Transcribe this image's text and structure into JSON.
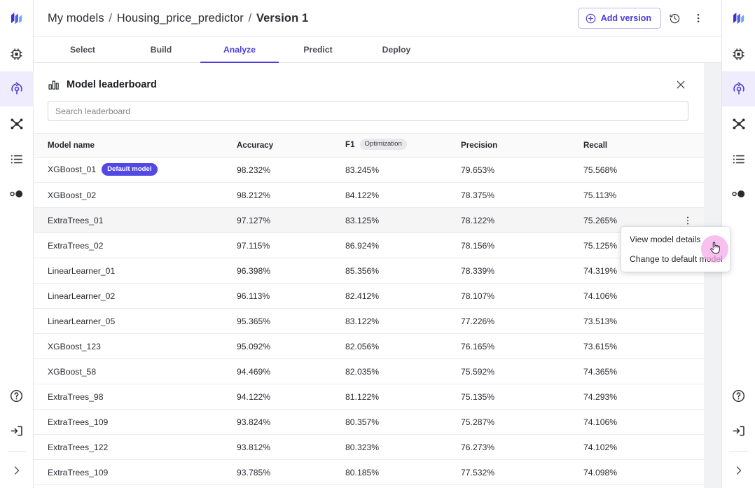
{
  "colors": {
    "accent": "#4c3fd8",
    "badge_default": "#5248e4",
    "rail_active_bg": "#eeecfd",
    "chip_bg": "#e9e9ec",
    "row_hover": "#f5f5f6",
    "cursor_blob": "#f5a8e8",
    "panel_bg": "#ffffff",
    "page_bg": "#f1f2f4"
  },
  "left_rail": {
    "items": [
      {
        "name": "app-logo",
        "icon": "logo-icon",
        "active": false
      },
      {
        "name": "sidebar-item-compute",
        "icon": "chip-icon",
        "active": false
      },
      {
        "name": "sidebar-item-models",
        "icon": "model-deploy-icon",
        "active": true
      },
      {
        "name": "sidebar-item-pipelines",
        "icon": "network-nodes-icon",
        "active": false
      },
      {
        "name": "sidebar-item-datasets",
        "icon": "list-icon",
        "active": false
      },
      {
        "name": "sidebar-item-experiments",
        "icon": "circles-icon",
        "active": false
      }
    ],
    "bottom_items": [
      {
        "name": "sidebar-item-help",
        "icon": "question-circle-icon"
      },
      {
        "name": "sidebar-item-signout",
        "icon": "sign-in-icon"
      },
      {
        "name": "sidebar-item-expand",
        "icon": "chevron-right-icon"
      }
    ]
  },
  "right_rail": {
    "items": [
      {
        "name": "app-logo",
        "icon": "logo-icon",
        "active": false
      },
      {
        "name": "sidebar-item-compute",
        "icon": "chip-icon",
        "active": false
      },
      {
        "name": "sidebar-item-models",
        "icon": "model-deploy-icon",
        "active": true
      },
      {
        "name": "sidebar-item-pipelines",
        "icon": "network-nodes-icon",
        "active": false
      },
      {
        "name": "sidebar-item-datasets",
        "icon": "list-icon",
        "active": false
      },
      {
        "name": "sidebar-item-experiments",
        "icon": "circles-icon",
        "active": false
      }
    ],
    "bottom_items": [
      {
        "name": "sidebar-item-help",
        "icon": "question-circle-icon"
      },
      {
        "name": "sidebar-item-signout",
        "icon": "sign-in-icon"
      },
      {
        "name": "sidebar-item-expand",
        "icon": "chevron-right-icon"
      }
    ]
  },
  "header": {
    "breadcrumb": {
      "root": "My models",
      "model": "Housing_price_predictor",
      "version": "Version 1",
      "separator": "/"
    },
    "add_version_label": "Add version",
    "add_version_icon": "plus-circle-icon",
    "history_icon": "history-clock-icon",
    "more_icon": "kebab-menu-icon"
  },
  "tabs": [
    {
      "label": "Select",
      "active": false
    },
    {
      "label": "Build",
      "active": false
    },
    {
      "label": "Analyze",
      "active": true
    },
    {
      "label": "Predict",
      "active": false
    },
    {
      "label": "Deploy",
      "active": false
    }
  ],
  "panel": {
    "title": "Model leaderboard",
    "title_icon": "bar-chart-icon",
    "close_icon": "close-icon",
    "search": {
      "placeholder": "Search leaderboard",
      "value": ""
    }
  },
  "table": {
    "columns": [
      {
        "label": "Model name",
        "chip": null
      },
      {
        "label": "Accuracy",
        "chip": null
      },
      {
        "label": "F1",
        "chip": "Optimization"
      },
      {
        "label": "Precision",
        "chip": null
      },
      {
        "label": "Recall",
        "chip": null
      }
    ],
    "rows": [
      {
        "name": "XGBoost_01",
        "badge": "Default model",
        "accuracy": "98.232%",
        "f1": "83.245%",
        "precision": "79.653%",
        "recall": "75.568%",
        "hovered": false,
        "kebab": false
      },
      {
        "name": "XGBoost_02",
        "badge": null,
        "accuracy": "98.212%",
        "f1": "84.122%",
        "precision": "78.375%",
        "recall": "75.113%",
        "hovered": false,
        "kebab": false
      },
      {
        "name": "ExtraTrees_01",
        "badge": null,
        "accuracy": "97.127%",
        "f1": "83.125%",
        "precision": "78.122%",
        "recall": "75.265%",
        "hovered": true,
        "kebab": true
      },
      {
        "name": "ExtraTrees_02",
        "badge": null,
        "accuracy": "97.115%",
        "f1": "86.924%",
        "precision": "78.156%",
        "recall": "75.125%",
        "hovered": false,
        "kebab": false
      },
      {
        "name": "LinearLearner_01",
        "badge": null,
        "accuracy": "96.398%",
        "f1": "85.356%",
        "precision": "78.339%",
        "recall": "74.319%",
        "hovered": false,
        "kebab": false
      },
      {
        "name": "LinearLearner_02",
        "badge": null,
        "accuracy": "96.113%",
        "f1": "82.412%",
        "precision": "78.107%",
        "recall": "74.106%",
        "hovered": false,
        "kebab": false
      },
      {
        "name": "LinearLearner_05",
        "badge": null,
        "accuracy": "95.365%",
        "f1": "83.122%",
        "precision": "77.226%",
        "recall": "73.513%",
        "hovered": false,
        "kebab": false
      },
      {
        "name": "XGBoost_123",
        "badge": null,
        "accuracy": "95.092%",
        "f1": "82.056%",
        "precision": "76.165%",
        "recall": "73.615%",
        "hovered": false,
        "kebab": false
      },
      {
        "name": "XGBoost_58",
        "badge": null,
        "accuracy": "94.469%",
        "f1": "82.035%",
        "precision": "75.592%",
        "recall": "74.365%",
        "hovered": false,
        "kebab": false
      },
      {
        "name": "ExtraTrees_98",
        "badge": null,
        "accuracy": "94.122%",
        "f1": "81.122%",
        "precision": "75.135%",
        "recall": "74.293%",
        "hovered": false,
        "kebab": false
      },
      {
        "name": "ExtraTrees_109",
        "badge": null,
        "accuracy": "93.824%",
        "f1": "80.357%",
        "precision": "75.287%",
        "recall": "74.106%",
        "hovered": false,
        "kebab": false
      },
      {
        "name": "ExtraTrees_122",
        "badge": null,
        "accuracy": "93.812%",
        "f1": "80.323%",
        "precision": "76.273%",
        "recall": "74.102%",
        "hovered": false,
        "kebab": false
      },
      {
        "name": "ExtraTrees_109",
        "badge": null,
        "accuracy": "93.785%",
        "f1": "80.185%",
        "precision": "77.532%",
        "recall": "74.098%",
        "hovered": false,
        "kebab": false
      }
    ]
  },
  "context_menu": {
    "items": [
      {
        "label": "View model details"
      },
      {
        "label": "Change to default model"
      }
    ]
  }
}
